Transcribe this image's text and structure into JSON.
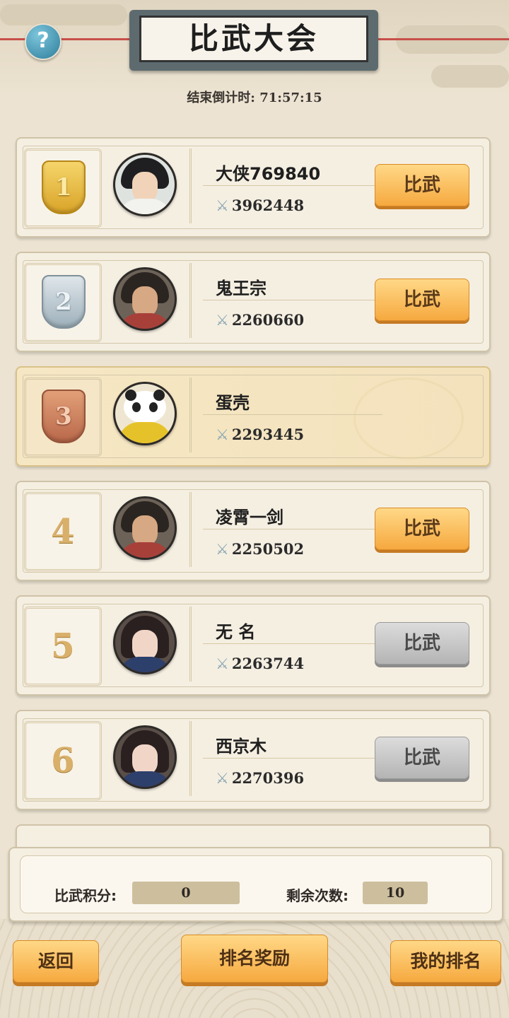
{
  "header": {
    "title": "比武大会",
    "help_icon": "?",
    "countdown_label": "结束倒计时:",
    "countdown_value": "71:57:15"
  },
  "players": [
    {
      "rank": "1",
      "rank_style": "gold-medal",
      "name": "大侠769840",
      "power": "3962448",
      "button": "比武",
      "button_enabled": true,
      "avatar": "avatar-hero-white"
    },
    {
      "rank": "2",
      "rank_style": "silver-medal",
      "name": "鬼王宗",
      "power": "2260660",
      "button": "比武",
      "button_enabled": true,
      "avatar": "avatar-warrior-red"
    },
    {
      "rank": "3",
      "rank_style": "bronze-medal",
      "name": "蛋壳",
      "power": "2293445",
      "button": "",
      "button_enabled": false,
      "avatar": "avatar-panda",
      "highlighted": true
    },
    {
      "rank": "4",
      "rank_style": "number",
      "name": "凌霄一剑",
      "power": "2250502",
      "button": "比武",
      "button_enabled": true,
      "avatar": "avatar-warrior-red"
    },
    {
      "rank": "5",
      "rank_style": "number",
      "name": "无 名",
      "power": "2263744",
      "button": "比武",
      "button_enabled": false,
      "avatar": "avatar-lady-blue"
    },
    {
      "rank": "6",
      "rank_style": "number",
      "name": "西京木",
      "power": "2270396",
      "button": "比武",
      "button_enabled": false,
      "avatar": "avatar-lady-blue"
    }
  ],
  "score_panel": {
    "points_label": "比武积分:",
    "points_value": "0",
    "remaining_label": "剩余次数:",
    "remaining_value": "10"
  },
  "footer": {
    "back": "返回",
    "rewards": "排名奖励",
    "my_rank": "我的排名"
  },
  "colors": {
    "button_active": "#f6a93f",
    "button_disabled": "#b4b4b4",
    "highlight_row": "#f6e7c4",
    "background": "#ece3d2"
  }
}
